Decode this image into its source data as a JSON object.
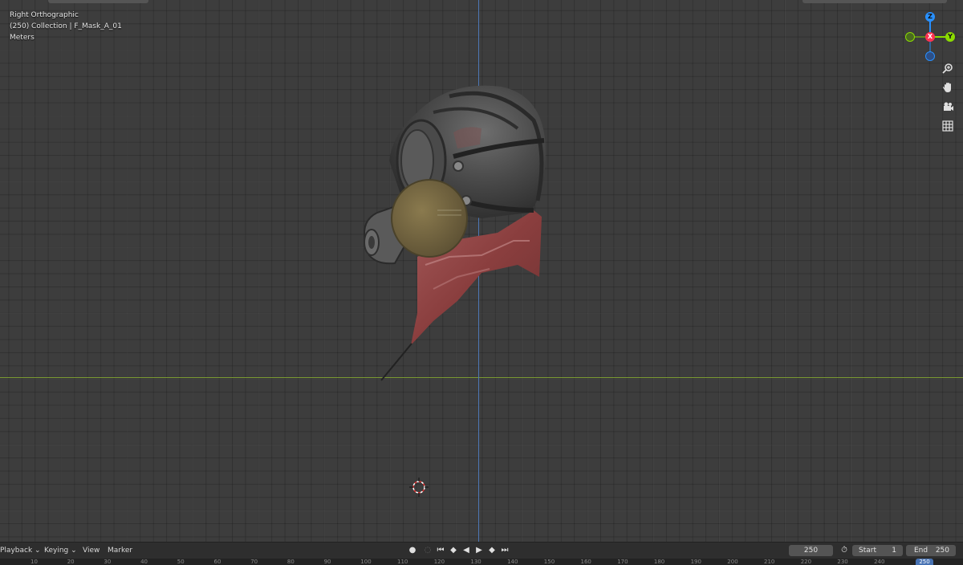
{
  "viewport": {
    "view_name": "Right Orthographic",
    "collection_info": "(250) Collection | F_Mask_A_01",
    "units": "Meters"
  },
  "gizmo": {
    "z": "Z",
    "y": "Y",
    "x": "X"
  },
  "tools": {
    "zoom_icon": "magnifier-plus",
    "pan_icon": "hand",
    "camera_icon": "camera",
    "grid_icon": "grid"
  },
  "timeline": {
    "menus": {
      "playback": "Playback",
      "keying": "Keying",
      "view": "View",
      "marker": "Marker"
    },
    "current_frame": "250",
    "start_label": "Start",
    "start_value": "1",
    "end_label": "End",
    "end_value": "250",
    "ruler_ticks": [
      "10",
      "20",
      "30",
      "40",
      "50",
      "60",
      "70",
      "80",
      "90",
      "100",
      "110",
      "120",
      "130",
      "140",
      "150",
      "160",
      "170",
      "180",
      "190",
      "200",
      "210",
      "220",
      "230",
      "240"
    ],
    "ruler_current": "250"
  },
  "colors": {
    "x_axis": "#ff3352",
    "y_axis": "#8bdc00",
    "z_axis": "#2890ff",
    "y_line": "#7a9a32",
    "z_line": "#4d77b5",
    "frame_highlight": "#4772b3"
  }
}
